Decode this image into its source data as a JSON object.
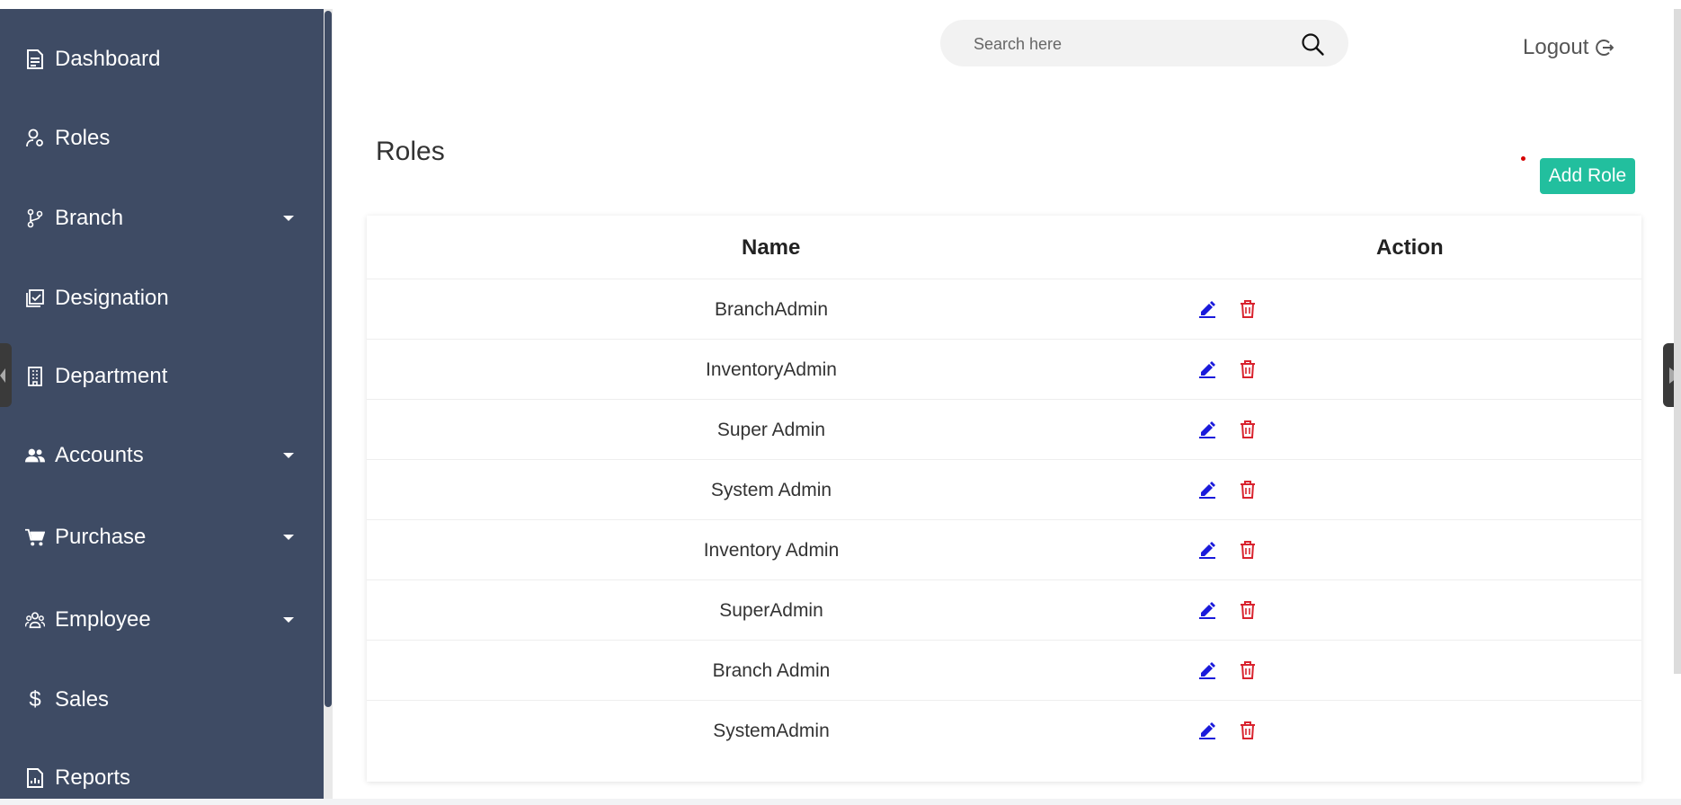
{
  "sidebar": {
    "items": [
      {
        "label": "Dashboard",
        "icon": "document-icon",
        "has_caret": false
      },
      {
        "label": "Roles",
        "icon": "user-gear-icon",
        "has_caret": false
      },
      {
        "label": "Branch",
        "icon": "git-branch-icon",
        "has_caret": true
      },
      {
        "label": "Designation",
        "icon": "checklist-icon",
        "has_caret": false
      },
      {
        "label": "Department",
        "icon": "building-icon",
        "has_caret": false
      },
      {
        "label": "Accounts",
        "icon": "users-icon",
        "has_caret": true
      },
      {
        "label": "Purchase",
        "icon": "cart-icon",
        "has_caret": true
      },
      {
        "label": "Employee",
        "icon": "people-group-icon",
        "has_caret": true
      },
      {
        "label": "Sales",
        "icon": "dollar-icon",
        "has_caret": false
      },
      {
        "label": "Reports",
        "icon": "report-icon",
        "has_caret": false
      }
    ]
  },
  "header": {
    "search_placeholder": "Search here",
    "logout_label": "Logout"
  },
  "page": {
    "title": "Roles",
    "add_button_label": "Add Role"
  },
  "table": {
    "columns": [
      "Name",
      "Action"
    ],
    "rows": [
      "BranchAdmin",
      "InventoryAdmin",
      "Super Admin",
      "System Admin",
      "Inventory Admin",
      "SuperAdmin",
      "Branch Admin",
      "SystemAdmin"
    ]
  },
  "colors": {
    "sidebar_bg": "#3e4b64",
    "accent": "#22bf9e",
    "edit_icon": "#1a1adb",
    "delete_icon": "#d9232e"
  }
}
